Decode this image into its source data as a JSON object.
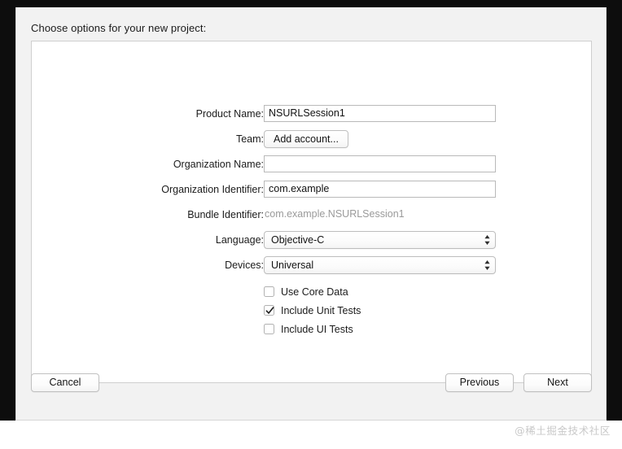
{
  "dialog": {
    "title": "Choose options for your new project:"
  },
  "form": {
    "rows": [
      {
        "label": "Product Name:",
        "value": "NSURLSession1",
        "placeholder": ""
      },
      {
        "label": "Team:",
        "button_label": "Add account..."
      },
      {
        "label": "Organization Name:",
        "value": "",
        "placeholder": ""
      },
      {
        "label": "Organization Identifier:",
        "value": "com.example",
        "placeholder": ""
      },
      {
        "label": "Bundle Identifier:",
        "value": "com.example.NSURLSession1"
      },
      {
        "label": "Language:",
        "value": "Objective-C"
      },
      {
        "label": "Devices:",
        "value": "Universal"
      }
    ]
  },
  "options": {
    "checkboxes": [
      {
        "label": "Use Core Data",
        "checked": false
      },
      {
        "label": "Include Unit Tests",
        "checked": true
      },
      {
        "label": "Include UI Tests",
        "checked": false
      }
    ]
  },
  "buttons": {
    "cancel": "Cancel",
    "previous": "Previous",
    "next": "Next"
  },
  "watermark": {
    "text": "@稀土掘金技术社区"
  },
  "colors": {
    "dialog_background": "#f2f2f2",
    "panel_background": "#ffffff",
    "text": "#1b1b1b",
    "muted_text": "#9a9a9a",
    "field_border": "#b9b9b9",
    "watermark": "#c9c9c9"
  }
}
